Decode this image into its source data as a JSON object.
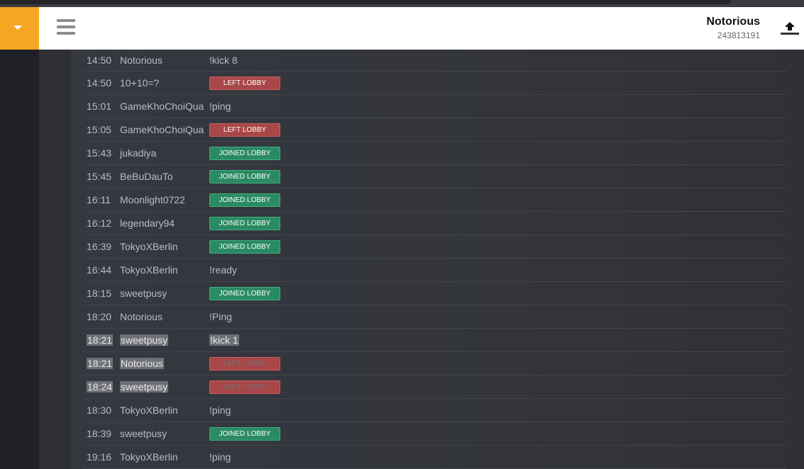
{
  "header": {
    "user_name": "Notorious",
    "user_id": "243813191"
  },
  "colors": {
    "accent": "#f5a623",
    "left_lobby": "#a84747",
    "joined_lobby": "#2a8a63"
  },
  "icons": {
    "menu_toggle": "caret-down-icon",
    "menu": "hamburger-icon",
    "avatar": "clan-logo"
  },
  "chat_log": [
    {
      "time": "14:50",
      "user": "Notorious",
      "message": "!kick 8",
      "type": "text",
      "selected": false
    },
    {
      "time": "14:50",
      "user": "10+10=?",
      "message": "LEFT LOBBY",
      "type": "left",
      "selected": false
    },
    {
      "time": "15:01",
      "user": "GameKhoChoiQua",
      "message": "!ping",
      "type": "text",
      "selected": false
    },
    {
      "time": "15:05",
      "user": "GameKhoChoiQua",
      "message": "LEFT LOBBY",
      "type": "left",
      "selected": false
    },
    {
      "time": "15:43",
      "user": "jukadiya",
      "message": "JOINED LOBBY",
      "type": "joined",
      "selected": false
    },
    {
      "time": "15:45",
      "user": "BeBuDauTo",
      "message": "JOINED LOBBY",
      "type": "joined",
      "selected": false
    },
    {
      "time": "16:11",
      "user": "Moonlight0722",
      "message": "JOINED LOBBY",
      "type": "joined",
      "selected": false
    },
    {
      "time": "16:12",
      "user": "legendary94",
      "message": "JOINED LOBBY",
      "type": "joined",
      "selected": false
    },
    {
      "time": "16:39",
      "user": "TokyoXBerlin",
      "message": "JOINED LOBBY",
      "type": "joined",
      "selected": false
    },
    {
      "time": "16:44",
      "user": "TokyoXBerlin",
      "message": "!ready",
      "type": "text",
      "selected": false
    },
    {
      "time": "18:15",
      "user": "sweetpusy",
      "message": "JOINED LOBBY",
      "type": "joined",
      "selected": false
    },
    {
      "time": "18:20",
      "user": "Notorious",
      "message": "!Ping",
      "type": "text",
      "selected": false
    },
    {
      "time": "18:21",
      "user": "sweetpusy",
      "message": "!kick 1",
      "type": "text",
      "selected": true
    },
    {
      "time": "18:21",
      "user": "Notorious",
      "message": "LEFT LOBBY",
      "type": "left",
      "selected": true
    },
    {
      "time": "18:24",
      "user": "sweetpusy",
      "message": "LEFT LOBBY",
      "type": "left",
      "selected": true
    },
    {
      "time": "18:30",
      "user": "TokyoXBerlin",
      "message": "!ping",
      "type": "text",
      "selected": false
    },
    {
      "time": "18:39",
      "user": "sweetpusy",
      "message": "JOINED LOBBY",
      "type": "joined",
      "selected": false
    },
    {
      "time": "19:16",
      "user": "TokyoXBerlin",
      "message": "!ping",
      "type": "text",
      "selected": false
    }
  ]
}
